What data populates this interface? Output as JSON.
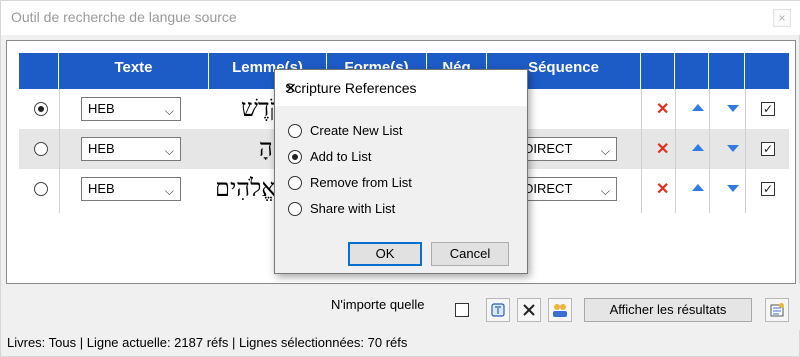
{
  "window": {
    "title": "Outil de recherche de langue source",
    "close_glyph": "×"
  },
  "grid": {
    "headers": [
      "Texte",
      "Lemme(s)",
      "Forme(s)",
      "Nég",
      "Séquence"
    ],
    "rows": [
      {
        "selected": true,
        "text": "HEB",
        "lemma": "קֹדֶשׁ",
        "sequence": "",
        "checked": true
      },
      {
        "selected": false,
        "text": "HEB",
        "lemma": "הָ",
        "sequence": "DIRECT",
        "checked": true
      },
      {
        "selected": false,
        "text": "HEB",
        "lemma": "אֱלֹהִים",
        "sequence": "DIRECT",
        "checked": true
      }
    ]
  },
  "dialog": {
    "title": "Scripture References",
    "options": [
      "Create New List",
      "Add to List",
      "Remove from List",
      "Share with List"
    ],
    "selected_index": 1,
    "ok_label": "OK",
    "cancel_label": "Cancel"
  },
  "bottom": {
    "any_label": "N'importe quelle",
    "show_results_label": "Afficher les résultats"
  },
  "status": "Livres: Tous | Ligne actuelle: 2187 réfs | Lignes sélectionnées: 70 réfs",
  "colors": {
    "header_blue": "#1d5bc6",
    "delete_red": "#e0301e",
    "arrow_blue": "#2f7de0"
  },
  "icons": [
    "close-icon",
    "chevron-down-icon",
    "delete-icon",
    "arrow-up-icon",
    "arrow-down-icon",
    "checkbox-icon",
    "book-icon",
    "clear-icon",
    "people-icon",
    "export-icon"
  ]
}
